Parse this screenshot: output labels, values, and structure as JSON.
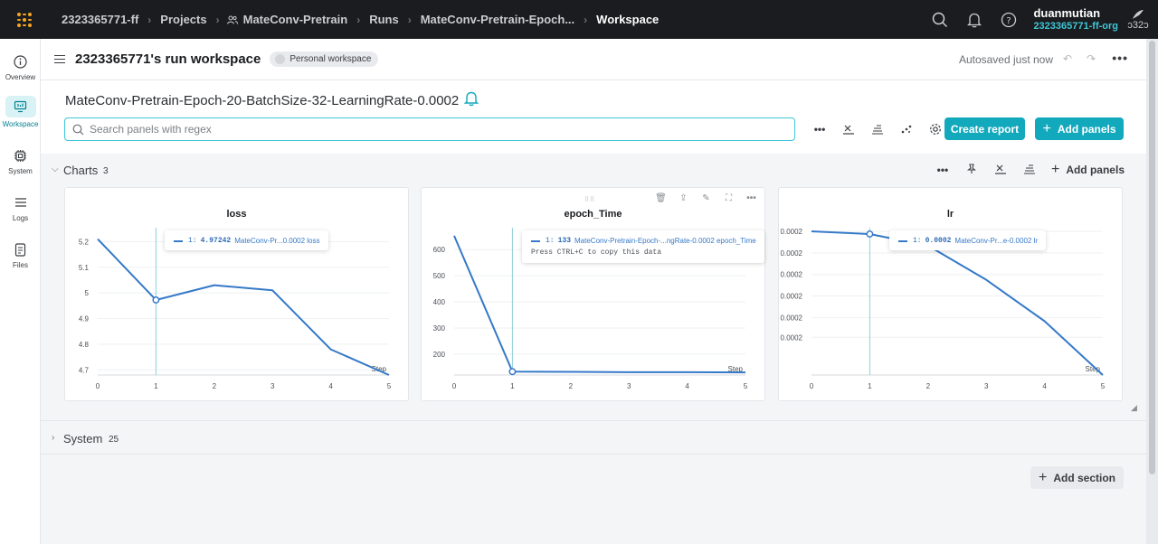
{
  "topbar": {
    "crumbs": [
      "2323365771-ff",
      "Projects",
      "MateConv-Pretrain",
      "Runs",
      "MateConv-Pretrain-Epoch...",
      "Workspace"
    ],
    "user_name": "duanmutian",
    "user_org": "2323365771-ff-org",
    "avatar_text": "ↄ32ↄ"
  },
  "sidebar": {
    "items": [
      {
        "label": "Overview",
        "icon": "info-icon"
      },
      {
        "label": "Workspace",
        "icon": "workspace-icon"
      },
      {
        "label": "System",
        "icon": "chip-icon"
      },
      {
        "label": "Logs",
        "icon": "list-icon"
      },
      {
        "label": "Files",
        "icon": "file-icon"
      }
    ]
  },
  "header": {
    "title": "2323365771's run workspace",
    "pill": "Personal workspace",
    "autosave": "Autosaved just now"
  },
  "run": {
    "title": "MateConv-Pretrain-Epoch-20-BatchSize-32-LearningRate-0.0002"
  },
  "search": {
    "placeholder": "Search panels with regex"
  },
  "buttons": {
    "create_report": "Create report",
    "add_panels": "Add panels",
    "add_section": "Add section"
  },
  "sections": {
    "charts": {
      "name": "Charts",
      "count": "3",
      "add_panels": "Add panels"
    },
    "system": {
      "name": "System",
      "count": "25"
    }
  },
  "chart_data": [
    {
      "type": "line",
      "title": "loss",
      "xlabel": "Step",
      "x": [
        0,
        1,
        2,
        3,
        4,
        5
      ],
      "y": [
        5.21,
        4.97242,
        5.03,
        5.01,
        4.78,
        4.68
      ],
      "xlim": [
        0,
        5
      ],
      "ylim": [
        4.68,
        5.24
      ],
      "yticks": [
        "5.2",
        "5.1",
        "5",
        "4.9",
        "4.8",
        "4.7"
      ],
      "ytick_values": [
        5.2,
        5.1,
        5.0,
        4.9,
        4.8,
        4.7
      ],
      "xticks": [
        "0",
        "1",
        "2",
        "3",
        "4",
        "5"
      ],
      "color": "#3579c8",
      "hover_index": 1,
      "tooltip": {
        "run": "1:",
        "value": "4.97242",
        "name": "MateConv-Pr...0.0002 loss"
      }
    },
    {
      "type": "line",
      "title": "epoch_Time",
      "xlabel": "Step",
      "x": [
        0,
        1,
        2,
        3,
        4,
        5
      ],
      "y": [
        653,
        133,
        132,
        131,
        131,
        130
      ],
      "xlim": [
        0,
        5
      ],
      "ylim": [
        120,
        670
      ],
      "yticks": [
        "600",
        "500",
        "400",
        "300",
        "200"
      ],
      "ytick_values": [
        600,
        500,
        400,
        300,
        200
      ],
      "xticks": [
        "0",
        "1",
        "2",
        "3",
        "4",
        "5"
      ],
      "color": "#3579c8",
      "hover_index": 1,
      "tooltip": {
        "run": "1:",
        "value": "133",
        "name": "MateConv-Pretrain-Epoch-...ngRate-0.0002 epoch_Time",
        "hint": "Press CTRL+C to copy this data"
      }
    },
    {
      "type": "line",
      "title": "lr",
      "xlabel": "Step",
      "x": [
        0,
        1,
        2,
        3,
        4,
        5
      ],
      "y": [
        0.0002,
        0.0001985,
        0.000192,
        0.000173,
        0.00015,
        0.00012
      ],
      "xlim": [
        0,
        5
      ],
      "ylim": [
        0.00012,
        0.0002
      ],
      "yticks": [
        "0.0002",
        "0.0002",
        "0.0002",
        "0.0002",
        "0.0002",
        "0.0002"
      ],
      "ytick_values": [
        0.0002,
        0.000188,
        0.000176,
        0.000164,
        0.000152,
        0.000141
      ],
      "xticks": [
        "0",
        "1",
        "2",
        "3",
        "4",
        "5"
      ],
      "color": "#3579c8",
      "hover_index": 1,
      "tooltip": {
        "run": "1:",
        "value": "0.0002",
        "name": "MateConv-Pr...e-0.0002 lr"
      }
    }
  ]
}
